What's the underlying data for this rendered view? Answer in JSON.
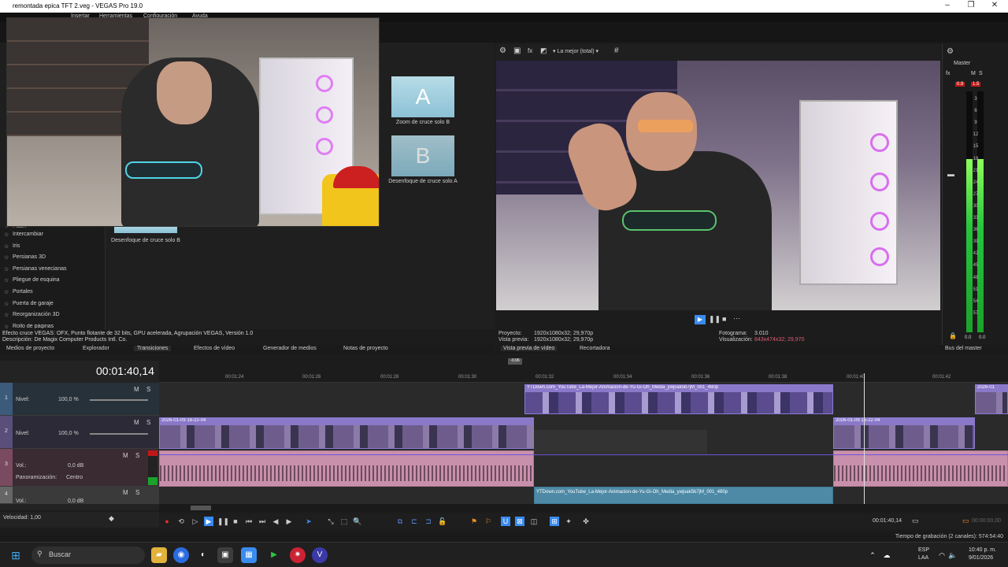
{
  "window": {
    "title": "remontada epica TFT 2.veg - VEGAS Pro 19.0",
    "minimize": "–",
    "maximize": "❐",
    "close": "✕"
  },
  "menu": [
    "Insertar",
    "Herramientas",
    "Configuración",
    "Ayuda"
  ],
  "transitions": {
    "list": [
      "Intercambiar",
      "Iris",
      "Persianas 3D",
      "Persianas venecianas",
      "Pliegue de esquina",
      "Portales",
      "Puerta de garaje",
      "Reorganización 3D",
      "Rollo de páginas"
    ],
    "list_top_partial": "Flash",
    "thumbs": [
      {
        "letter": "A",
        "label": "Zoom de cruce solo B"
      },
      {
        "letter": "B",
        "label": "Desenfoque de cruce solo A"
      },
      {
        "letter": "",
        "label": "Desenfoque de cruce solo B"
      }
    ],
    "status_line1": "Efecto cruce VEGAS: OFX, Punto flotante de 32 bits, GPU acelerada, Agrupación VEGAS, Versión 1.0",
    "status_line2": "Descripción: De Magix Computer Products Intl. Co."
  },
  "left_tabs": [
    "Medios de proyecto",
    "Explorador",
    "Transiciones",
    "Efectos de vídeo",
    "Generador de medios",
    "Notas de proyecto"
  ],
  "preview": {
    "quality": "La mejor (total)",
    "tabs": [
      "Vista previa de vídeo",
      "Recortadora"
    ],
    "proyecto_label": "Proyecto:",
    "proyecto_value": "1920x1080x32; 29,970p",
    "vista_label": "Vista previa:",
    "vista_value": "1920x1080x32; 29,970p",
    "fotograma_label": "Fotograma:",
    "fotograma_value": "3.010",
    "visualizacion_label": "Visualización:",
    "visualizacion_value": "843x474x32; 29,970"
  },
  "master": {
    "label": "Master",
    "tab": "Bus del master",
    "peak_l": "0.9",
    "peak_r": "1.5",
    "scale": [
      "3",
      "6",
      "9",
      "12",
      "15",
      "18",
      "21",
      "24",
      "27",
      "30",
      "33",
      "36",
      "39",
      "42",
      "45",
      "48",
      "51",
      "54",
      "57"
    ],
    "bottom_l": "0.0",
    "bottom_r": "0.0",
    "level_l": 0.72,
    "level_r": 0.72
  },
  "timeline": {
    "timecode": "00:01:40,14",
    "ruler": [
      "00:01:24",
      "00:01:26",
      "00:01:28",
      "00:01:30",
      "00:01:32",
      "00:01:34",
      "00:01:36",
      "00:01:38",
      "00:01:40",
      "00:01:42"
    ],
    "tracks": [
      {
        "num": "1",
        "label": "Nivel:",
        "value": "100,0 %"
      },
      {
        "num": "2",
        "label": "Nivel:",
        "value": "100,0 %"
      },
      {
        "num": "3",
        "label": "Vol.:",
        "value": "0,0 dB",
        "pan_label": "Panoramización:",
        "pan_value": "Centro"
      },
      {
        "num": "4",
        "label": "Vol.:",
        "value": "0,0 dB"
      }
    ],
    "clip_yugioh": "YTDown.com_YouTube_La-Mejor-Animacion-de-Yu-Gi-Oh_Media_ywjsak5b7jM_001_480p",
    "clip_yugioh_audio": "YTDown.com_YouTube_La-Mejor-Animacion-de-Yu-Gi-Oh_Media_ywjsak5b7jM_001_480p",
    "clip_cam": "2026-01-09 16-22-04",
    "clip_cam2": "2026-01-09 16-22-04",
    "clip_right_top": "2026-01",
    "loop_marker": "-0.06",
    "velocidad_label": "Velocidad: 1,00",
    "end_time": "00:01:40,14",
    "end_time_right": "00:00:00,00"
  },
  "status": {
    "recording": "Tiempo de grabación (2 canales): 574:54:40"
  },
  "taskbar": {
    "search": "Buscar",
    "lang1": "ESP",
    "lang2": "LAA",
    "time": "10:40 p. m.",
    "date": "9/01/2026"
  }
}
